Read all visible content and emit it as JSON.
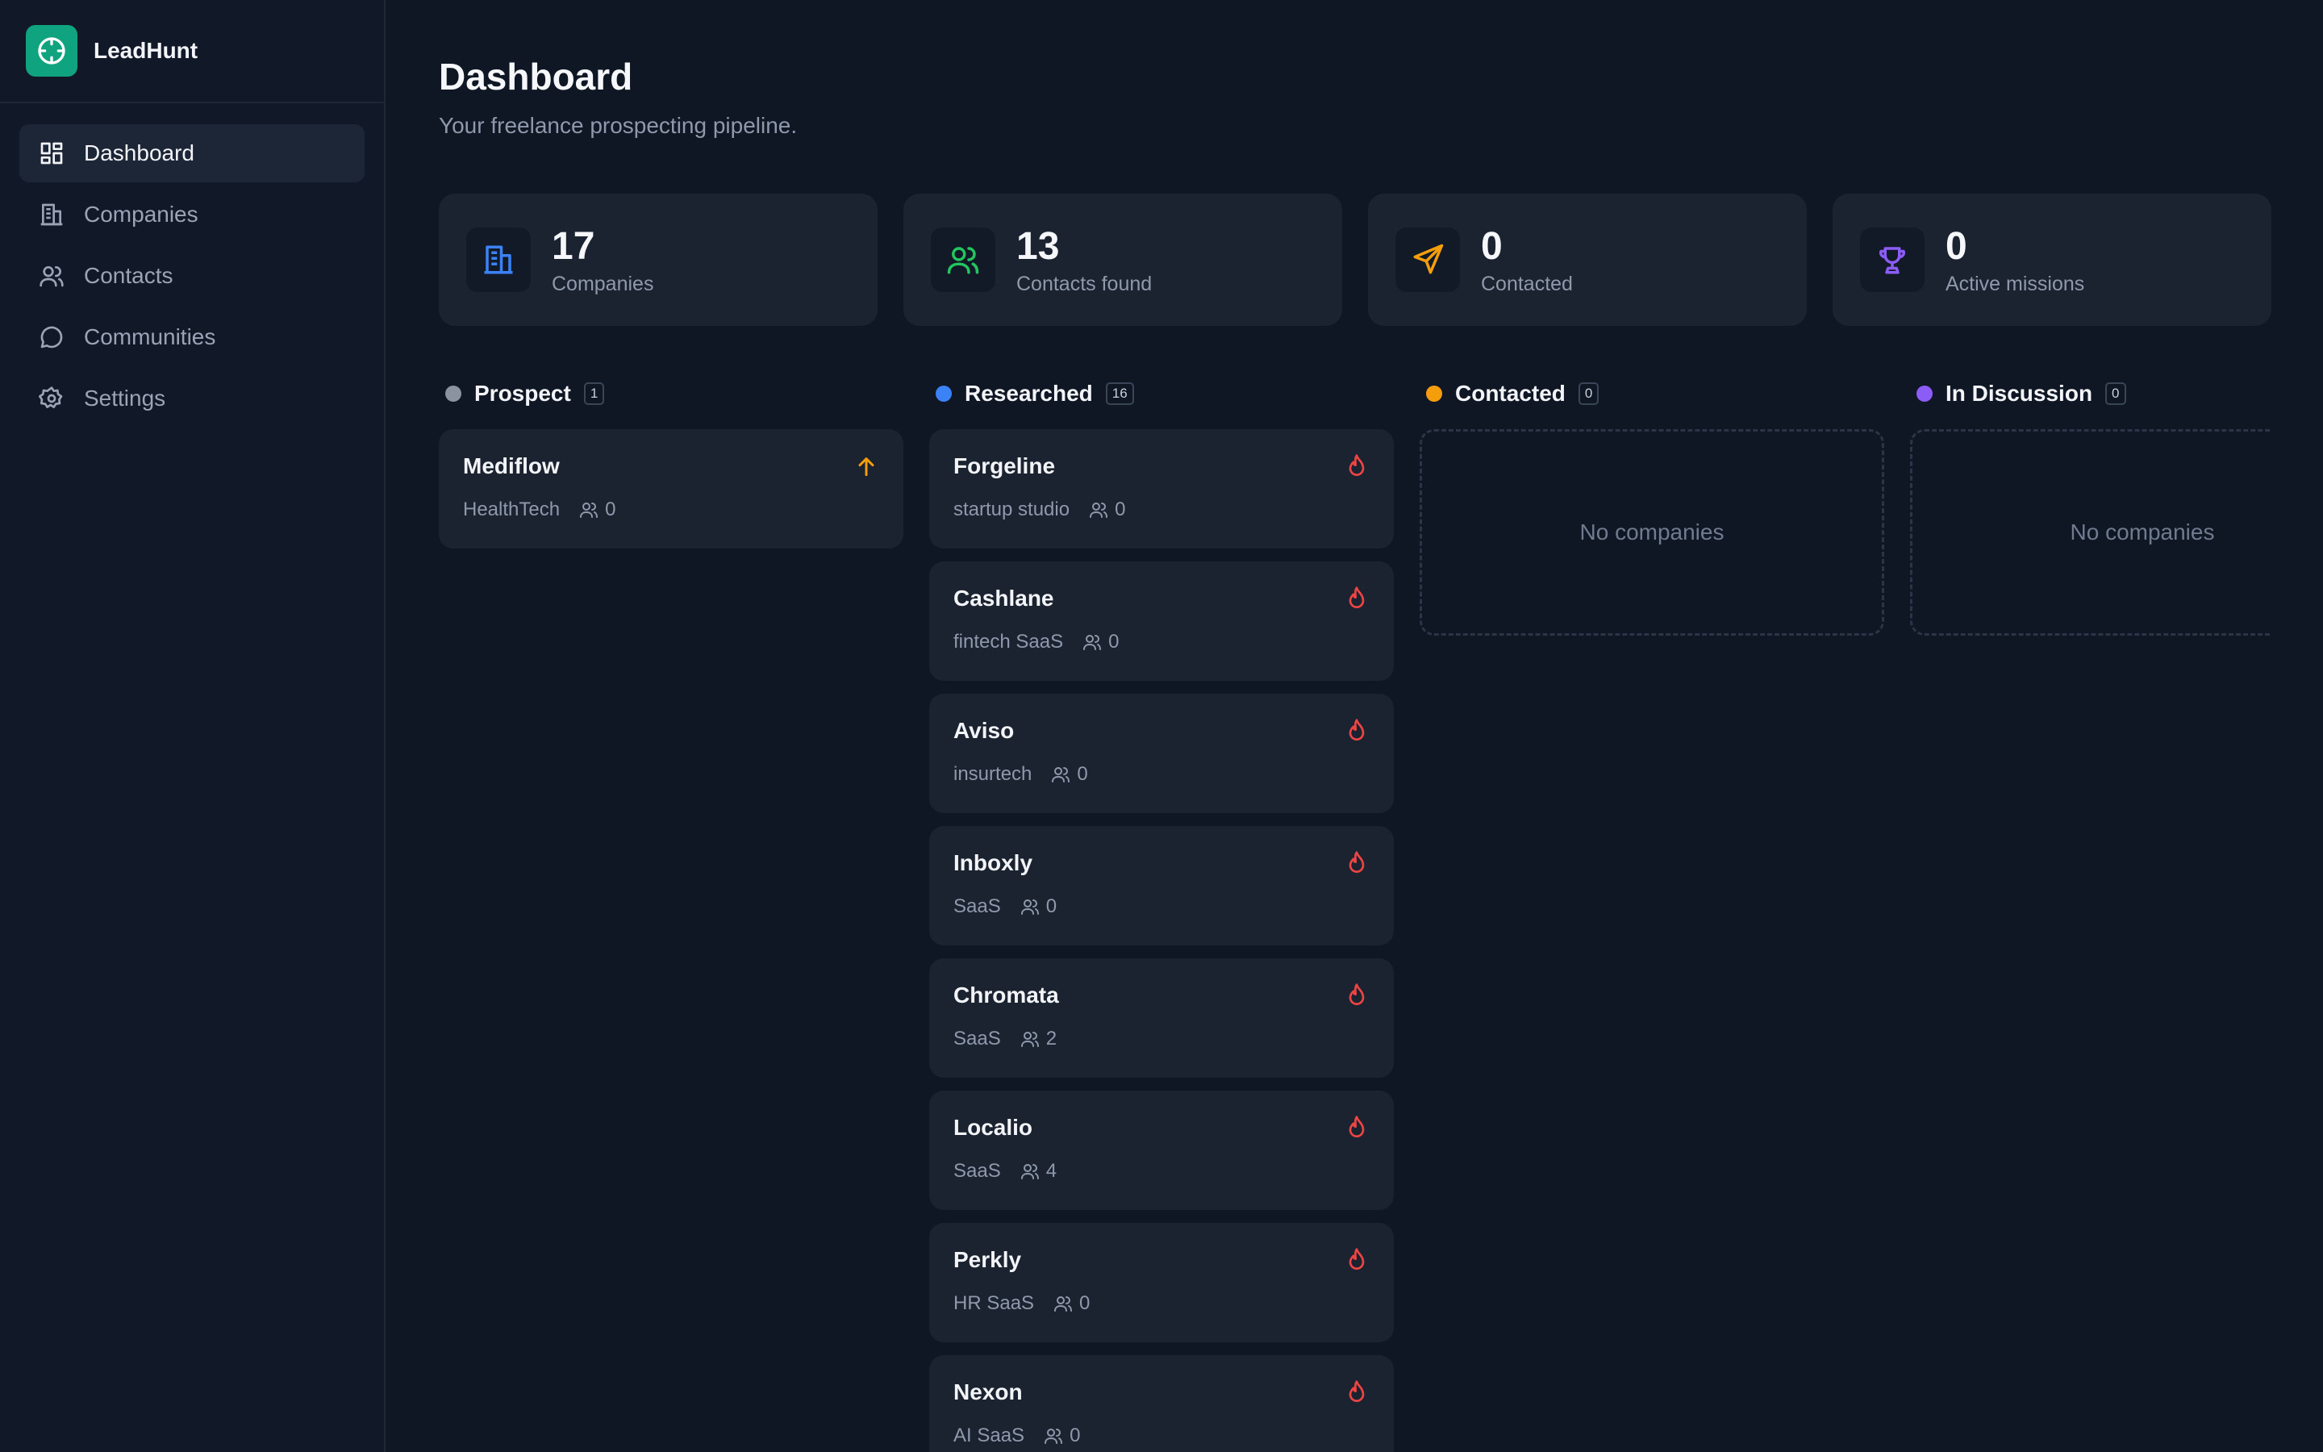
{
  "app": {
    "name": "LeadHunt"
  },
  "sidebar": {
    "items": [
      {
        "label": "Dashboard",
        "icon": "dashboard-icon",
        "active": true
      },
      {
        "label": "Companies",
        "icon": "building-icon"
      },
      {
        "label": "Contacts",
        "icon": "users-icon"
      },
      {
        "label": "Communities",
        "icon": "chat-icon"
      },
      {
        "label": "Settings",
        "icon": "gear-icon"
      }
    ]
  },
  "header": {
    "title": "Dashboard",
    "subtitle": "Your freelance prospecting pipeline."
  },
  "stats": [
    {
      "value": "17",
      "label": "Companies",
      "icon": "building-icon",
      "color": "#3b82f6"
    },
    {
      "value": "13",
      "label": "Contacts found",
      "icon": "users-icon",
      "color": "#22c55e"
    },
    {
      "value": "0",
      "label": "Contacted",
      "icon": "send-icon",
      "color": "#f59e0b"
    },
    {
      "value": "0",
      "label": "Active missions",
      "icon": "trophy-icon",
      "color": "#8b5cf6"
    }
  ],
  "columns": [
    {
      "title": "Prospect",
      "count": "1",
      "color": "#8b93a1",
      "cards": [
        {
          "name": "Mediflow",
          "tag": "HealthTech",
          "contacts": "0",
          "flag": "arrow-up-icon"
        }
      ]
    },
    {
      "title": "Researched",
      "count": "16",
      "color": "#3b82f6",
      "cards": [
        {
          "name": "Forgeline",
          "tag": "startup studio",
          "contacts": "0",
          "flag": "flame-icon"
        },
        {
          "name": "Cashlane",
          "tag": "fintech SaaS",
          "contacts": "0",
          "flag": "flame-icon"
        },
        {
          "name": "Aviso",
          "tag": "insurtech",
          "contacts": "0",
          "flag": "flame-icon"
        },
        {
          "name": "Inboxly",
          "tag": "SaaS",
          "contacts": "0",
          "flag": "flame-icon"
        },
        {
          "name": "Chromata",
          "tag": "SaaS",
          "contacts": "2",
          "flag": "flame-icon"
        },
        {
          "name": "Localio",
          "tag": "SaaS",
          "contacts": "4",
          "flag": "flame-icon"
        },
        {
          "name": "Perkly",
          "tag": "HR SaaS",
          "contacts": "0",
          "flag": "flame-icon"
        },
        {
          "name": "Nexon",
          "tag": "AI SaaS",
          "contacts": "0",
          "flag": "flame-icon"
        }
      ]
    },
    {
      "title": "Contacted",
      "count": "0",
      "color": "#f59e0b",
      "empty_text": "No companies",
      "cards": []
    },
    {
      "title": "In Discussion",
      "count": "0",
      "color": "#8b5cf6",
      "empty_text": "No companies",
      "cards": []
    }
  ]
}
